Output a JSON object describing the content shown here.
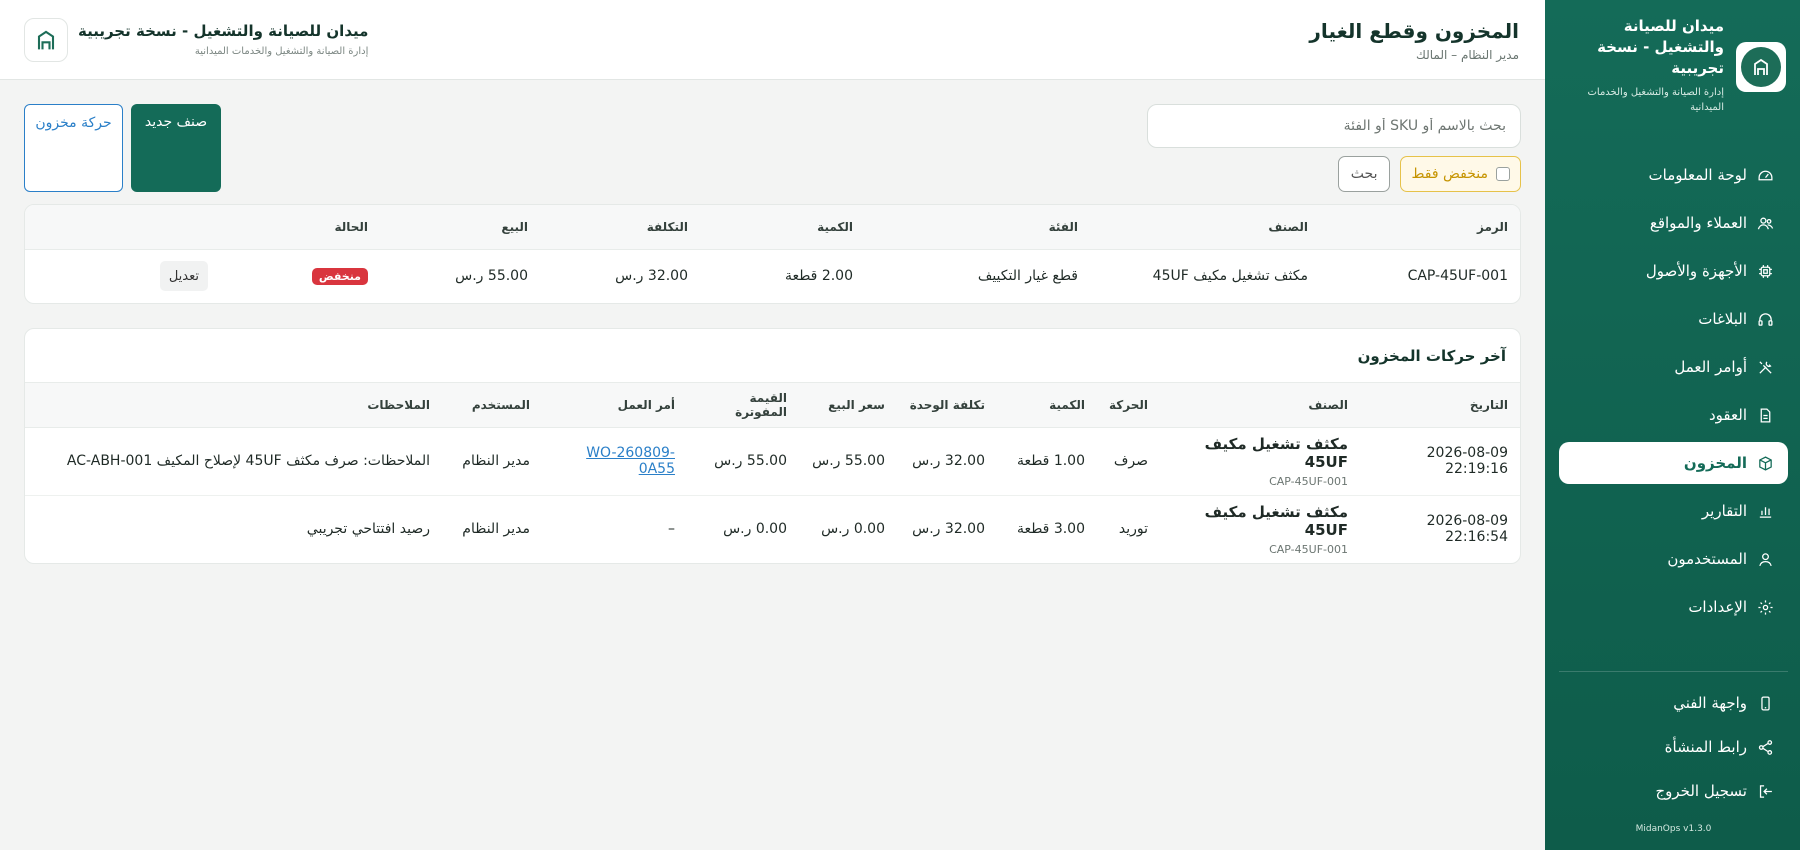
{
  "sidebar": {
    "brand_title": "ميدان للصيانة والتشغيل - نسخة تجريبية",
    "brand_sub": "إدارة الصيانة والتشغيل والخدمات الميدانية",
    "items": [
      {
        "label": "لوحة المعلومات",
        "icon": "dashboard-icon"
      },
      {
        "label": "العملاء والمواقع",
        "icon": "users-icon"
      },
      {
        "label": "الأجهزة والأصول",
        "icon": "chip-icon"
      },
      {
        "label": "البلاغات",
        "icon": "headset-icon"
      },
      {
        "label": "أوامر العمل",
        "icon": "tools-icon"
      },
      {
        "label": "العقود",
        "icon": "document-icon"
      },
      {
        "label": "المخزون",
        "icon": "box-icon"
      },
      {
        "label": "التقارير",
        "icon": "bar-chart-icon"
      },
      {
        "label": "المستخدمون",
        "icon": "user-icon"
      },
      {
        "label": "الإعدادات",
        "icon": "gear-icon"
      }
    ],
    "active_index": 6,
    "bottom": [
      {
        "label": "واجهة الفني",
        "icon": "mobile-icon"
      },
      {
        "label": "رابط المنشأة",
        "icon": "share-icon"
      },
      {
        "label": "تسجيل الخروج",
        "icon": "logout-icon"
      }
    ],
    "version": "MidanOps v1.3.0"
  },
  "topbar": {
    "title": "المخزون وقطع الغيار",
    "subtitle": "مدير النظام – المالك",
    "org_title": "ميدان للصيانة والتشغيل - نسخة تجريبية",
    "org_sub": "إدارة الصيانة والتشغيل والخدمات الميدانية"
  },
  "toolbar": {
    "search_placeholder": "بحث بالاسم أو SKU أو الفئة",
    "low_only_label": "منخفض فقط",
    "search_label": "بحث",
    "new_item_label": "صنف جديد",
    "movement_label": "حركة مخزون"
  },
  "inventory": {
    "headers": [
      "الرمز",
      "الصنف",
      "الفئة",
      "الكمية",
      "التكلفة",
      "البيع",
      "الحالة",
      ""
    ],
    "rows": [
      {
        "code": "CAP-45UF-001",
        "name": "مكثف تشغيل مكيف 45UF",
        "category": "قطع غيار التكييف",
        "qty": "2.00 قطعة",
        "cost": "32.00 ر.س",
        "price": "55.00 ر.س",
        "status": "منخفض",
        "action": "تعديل"
      }
    ]
  },
  "movements": {
    "title": "آخر حركات المخزون",
    "headers": [
      "التاريخ",
      "الصنف",
      "الحركة",
      "الكمية",
      "تكلفة الوحدة",
      "سعر البيع",
      "القيمة المفوترة",
      "أمر العمل",
      "المستخدم",
      "الملاحظات"
    ],
    "rows": [
      {
        "date": "2026-08-09 22:19:16",
        "name": "مكثف تشغيل مكيف 45UF",
        "code": "CAP-45UF-001",
        "type": "صرف",
        "qty": "1.00 قطعة",
        "unit_cost": "32.00 ر.س",
        "sale_price": "55.00 ر.س",
        "billed": "55.00 ر.س",
        "work_order": "WO-260809-0A55",
        "user": "مدير النظام",
        "notes": "الملاحظات: صرف مكثف 45UF لإصلاح المكيف AC-ABH-001"
      },
      {
        "date": "2026-08-09 22:16:54",
        "name": "مكثف تشغيل مكيف 45UF",
        "code": "CAP-45UF-001",
        "type": "توريد",
        "qty": "3.00 قطعة",
        "unit_cost": "32.00 ر.س",
        "sale_price": "0.00 ر.س",
        "billed": "0.00 ر.س",
        "work_order": "–",
        "user": "مدير النظام",
        "notes": "رصيد افتتاحي تجريبي"
      }
    ]
  },
  "colors": {
    "brand": "#146b58",
    "accent_blue": "#2a7fc8",
    "warning": "#e6c24a",
    "danger": "#d9353e"
  }
}
